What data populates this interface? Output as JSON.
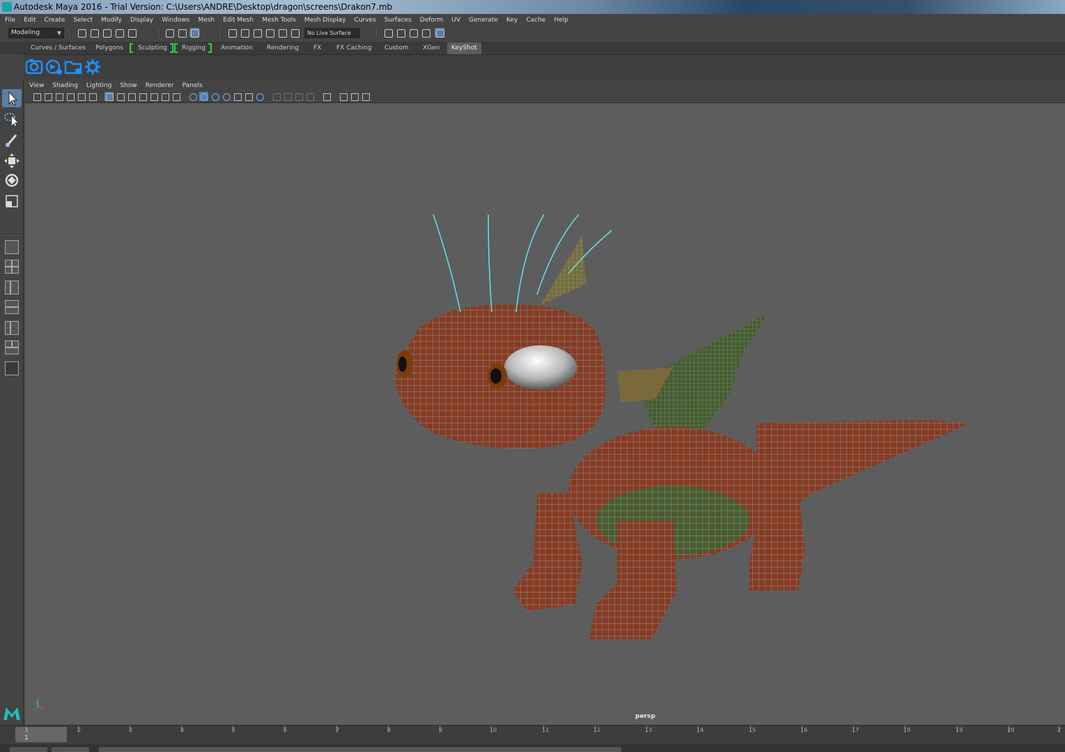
{
  "window": {
    "title": "Autodesk Maya 2016 - Trial Version: C:\\Users\\ANDRE\\Desktop\\dragon\\screens\\Drakon7.mb"
  },
  "menubar": {
    "items": [
      "File",
      "Edit",
      "Create",
      "Select",
      "Modify",
      "Display",
      "Windows",
      "Mesh",
      "Edit Mesh",
      "Mesh Tools",
      "Mesh Display",
      "Curves",
      "Surfaces",
      "Deform",
      "UV",
      "Generate",
      "Key",
      "Cache",
      "Help"
    ]
  },
  "statusline": {
    "mode": "Modeling",
    "live_surface": "No Live Surface"
  },
  "shelf": {
    "tabs": [
      "Curves / Surfaces",
      "Polygons",
      "Sculpting",
      "Rigging",
      "Animation",
      "Rendering",
      "FX",
      "FX Caching",
      "Custom",
      "XGen",
      "KeyShot"
    ],
    "active_tab": "KeyShot",
    "icons": [
      "keyshot-camera-icon",
      "keyshot-render-icon",
      "keyshot-folder-icon",
      "keyshot-settings-icon"
    ]
  },
  "viewport": {
    "menu": [
      "View",
      "Shading",
      "Lighting",
      "Show",
      "Renderer",
      "Panels"
    ],
    "camera": "persp",
    "model": "dragon"
  },
  "timeline": {
    "ticks": [
      "1",
      "2",
      "3",
      "4",
      "5",
      "6",
      "7",
      "8",
      "9",
      "10",
      "11",
      "12",
      "13",
      "14",
      "15",
      "16",
      "17",
      "18",
      "19",
      "20",
      "2"
    ],
    "current_frame": "1"
  },
  "colors": {
    "viewport_bg": "#5d5d5d",
    "wire": "#5fe3ee",
    "skin": "#8a3a22",
    "belly": "#4f5a2d",
    "accent": "#5b7fa6",
    "keyshot_blue": "#1e90ff"
  }
}
